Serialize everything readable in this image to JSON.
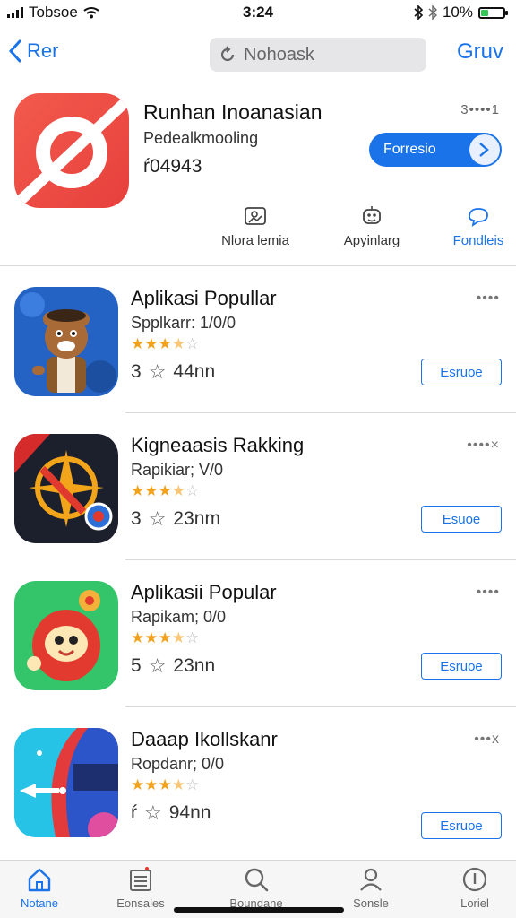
{
  "status": {
    "carrier": "Tobsoe",
    "time": "3:24",
    "battery": "10%",
    "battery_level": 0.1
  },
  "nav": {
    "back_label": "Rer",
    "search_placeholder": "Nohoask",
    "share_label": "Gruv"
  },
  "hero": {
    "title": "Runhan Inoanasian",
    "subtitle": "Pedealkmooling",
    "rating": "ŕ04943",
    "dots": "3••••1",
    "button_label": "Forresio",
    "actions": [
      {
        "label": "Nlora lemia",
        "icon": "photo-icon"
      },
      {
        "label": "Apyinlarg",
        "icon": "robot-icon"
      },
      {
        "label": "Fondleis",
        "icon": "chat-bubble-icon"
      }
    ]
  },
  "apps": [
    {
      "name": "Aplikasi Popullar",
      "sub": "Spplkarr: 1/0/0",
      "rating": 3.5,
      "meta_prefix": "3",
      "meta_size": "44nn",
      "dots": "••••",
      "button": "Esruoe",
      "icon": "bear-character-icon"
    },
    {
      "name": "Kigneaasis Rakking",
      "sub": "Rapikiar; V/0",
      "rating": 3.5,
      "meta_prefix": "3",
      "meta_size": "23nm",
      "dots": "••••×",
      "button": "Esuoe",
      "icon": "compass-game-icon"
    },
    {
      "name": "Aplikasii Popular",
      "sub": "Rapikam; 0/0",
      "rating": 3.5,
      "meta_prefix": "5",
      "meta_size": "23nn",
      "dots": "••••",
      "button": "Esruoe",
      "icon": "red-mascot-icon"
    },
    {
      "name": "Daaap Ikollskanr",
      "sub": "Ropdanr; 0/0",
      "rating": 3.5,
      "meta_prefix": "ŕ",
      "meta_size": "94nn",
      "dots": "•••x",
      "button": "Esruoe",
      "icon": "racing-game-icon"
    }
  ],
  "tabs": [
    {
      "label": "Notane",
      "icon": "home-icon",
      "active": true
    },
    {
      "label": "Eonsales",
      "icon": "list-icon",
      "active": false
    },
    {
      "label": "Boundane",
      "icon": "search-icon",
      "active": false
    },
    {
      "label": "Sonsle",
      "icon": "person-icon",
      "active": false
    },
    {
      "label": "Loriel",
      "icon": "info-icon",
      "active": false
    }
  ],
  "colors": {
    "accent": "#1a73e8",
    "star": "#f4a11a",
    "hero_icon": "#e7403d",
    "battery": "#34c759"
  }
}
